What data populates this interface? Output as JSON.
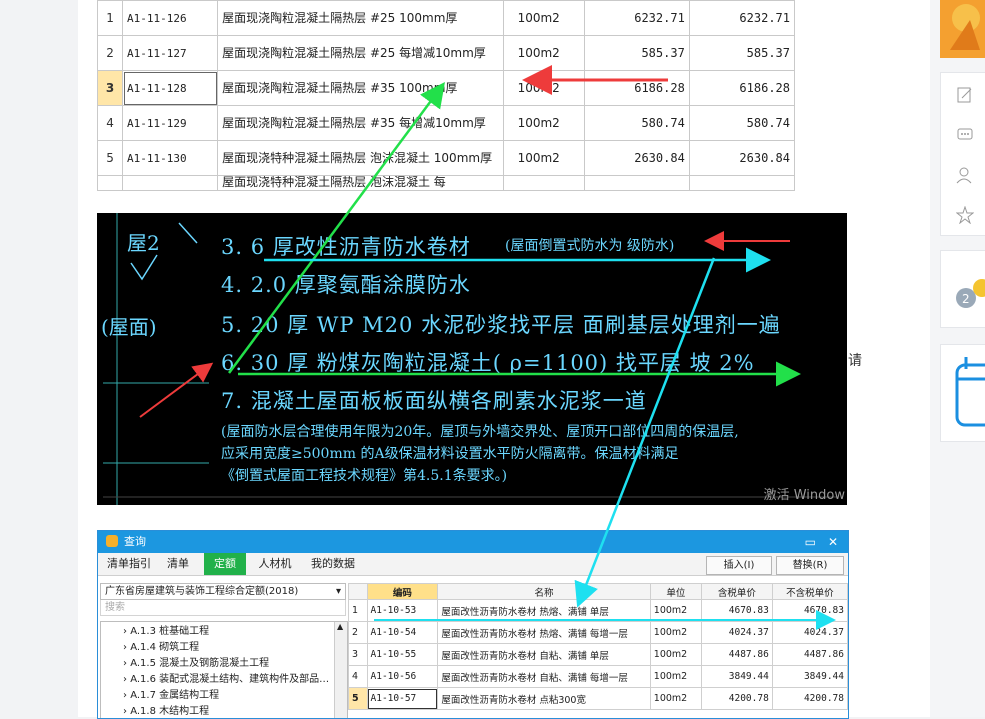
{
  "top_table": {
    "rows": [
      {
        "idx": "1",
        "code": "A1-11-126",
        "name": "屋面现浇陶粒混凝土隔热层 #25 100mm厚",
        "unit": "100m2",
        "price_tax": "6232.71",
        "price": "6232.71"
      },
      {
        "idx": "2",
        "code": "A1-11-127",
        "name": "屋面现浇陶粒混凝土隔热层 #25 每增减10mm厚",
        "unit": "100m2",
        "price_tax": "585.37",
        "price": "585.37"
      },
      {
        "idx": "3",
        "code": "A1-11-128",
        "name": "屋面现浇陶粒混凝土隔热层 #35 100mm厚",
        "unit": "100m2",
        "price_tax": "6186.28",
        "price": "6186.28"
      },
      {
        "idx": "4",
        "code": "A1-11-129",
        "name": "屋面现浇陶粒混凝土隔热层 #35 每增减10mm厚",
        "unit": "100m2",
        "price_tax": "580.74",
        "price": "580.74"
      },
      {
        "idx": "5",
        "code": "A1-11-130",
        "name": "屋面现浇特种混凝土隔热层 泡沫混凝土 100mm厚",
        "unit": "100m2",
        "price_tax": "2630.84",
        "price": "2630.84"
      },
      {
        "idx": "",
        "code": "",
        "name": "屋面现浇特种混凝土隔热层 泡沫混凝土 每",
        "unit": "",
        "price_tax": "",
        "price": ""
      }
    ]
  },
  "cad": {
    "label_roof2": "屋2",
    "label_roof": "(屋面)",
    "line3": "3. 6 厚改性沥青防水卷材",
    "line3_note": "(屋面倒置式防水为 级防水)",
    "line4": "4. 2.0 厚聚氨酯涂膜防水",
    "line5": "5. 20 厚 WP M20   水泥砂浆找平层 面刷基层处理剂一遍",
    "line6": "6. 30 厚 粉煤灰陶粒混凝土( ρ=1100) 找平层    坡       2%",
    "line7": "7. 混凝土屋面板板面纵横各刷素水泥浆一道",
    "note1": "(屋面防水层合理使用年限为20年。屋顶与外墙交界处、屋顶开口部位四周的保温层,",
    "note2": "应采用宽度≥500mm 的A级保温材料设置水平防火隔离带。保温材料满足",
    "note3": "《倒置式屋面工程技术规程》第4.5.1条要求。)",
    "watermark": "激活 Window"
  },
  "side": {
    "qing": "请"
  },
  "dialog": {
    "title": "查询",
    "tabs": [
      "清单指引",
      "清单",
      "定额",
      "人材机",
      "我的数据"
    ],
    "active_tab": "定额",
    "insert_btn": "插入(I)",
    "replace_btn": "替换(R)",
    "library": "广东省房屋建筑与装饰工程综合定额(2018)",
    "search_placeholder": "搜索",
    "tree": [
      "A.1.3 桩基础工程",
      "A.1.4 砌筑工程",
      "A.1.5 混凝土及钢筋混凝土工程",
      "A.1.6 装配式混凝土结构、建筑构件及部品…",
      "A.1.7 金属结构工程",
      "A.1.8 木结构工程"
    ],
    "columns": [
      "编码",
      "名称",
      "单位",
      "含税单价",
      "不含税单价"
    ],
    "rows": [
      {
        "idx": "1",
        "code": "A1-10-53",
        "name": "屋面改性沥青防水卷材 热熔、满铺 单层",
        "unit": "100m2",
        "tax": "4670.83",
        "notax": "4670.83"
      },
      {
        "idx": "2",
        "code": "A1-10-54",
        "name": "屋面改性沥青防水卷材 热熔、满铺 每增一层",
        "unit": "100m2",
        "tax": "4024.37",
        "notax": "4024.37"
      },
      {
        "idx": "3",
        "code": "A1-10-55",
        "name": "屋面改性沥青防水卷材 自粘、满铺 单层",
        "unit": "100m2",
        "tax": "4487.86",
        "notax": "4487.86"
      },
      {
        "idx": "4",
        "code": "A1-10-56",
        "name": "屋面改性沥青防水卷材 自粘、满铺 每增一层",
        "unit": "100m2",
        "tax": "3849.44",
        "notax": "3849.44"
      },
      {
        "idx": "5",
        "code": "A1-10-57",
        "name": "屋面改性沥青防水卷材 点粘300宽",
        "unit": "100m2",
        "tax": "4200.78",
        "notax": "4200.78"
      }
    ]
  },
  "colors": {
    "green_arrow": "#22e04a",
    "cyan_arrow": "#1ee0f0",
    "red_arrow": "#ee3b3b",
    "dialog_blue": "#1c97e0",
    "active_tab": "#21b14a"
  }
}
